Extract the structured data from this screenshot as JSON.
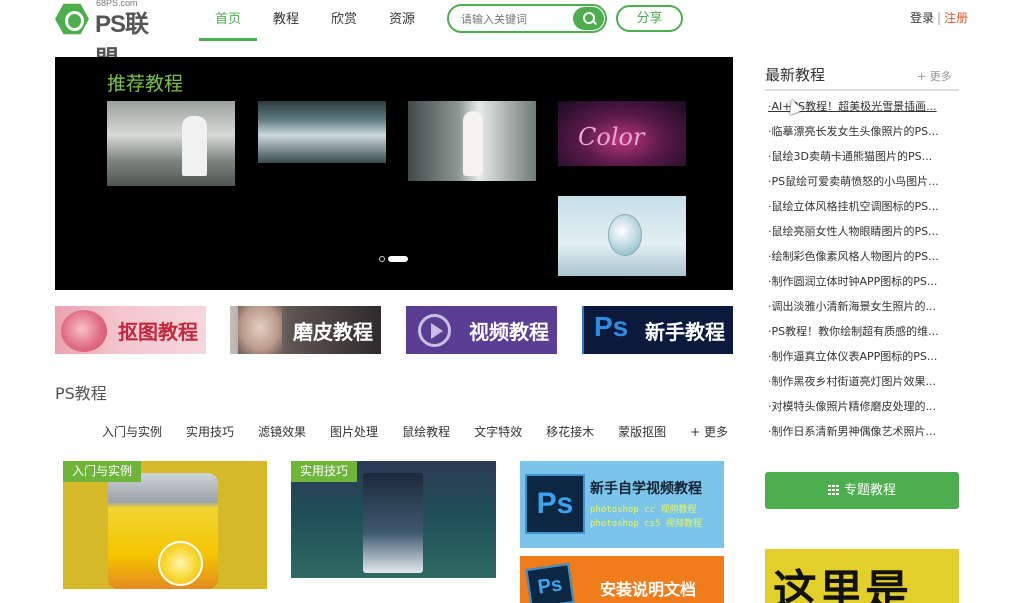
{
  "logo": {
    "sub": "68PS.com",
    "brand": "PS联盟"
  },
  "nav": {
    "items": [
      "首页",
      "教程",
      "欣赏",
      "资源"
    ]
  },
  "search": {
    "placeholder": "请输入关键词"
  },
  "share_label": "分享",
  "auth": {
    "login": "登录",
    "sep": "|",
    "register": "注册"
  },
  "banner": {
    "title": "推荐教程",
    "thumb4_text": "Color"
  },
  "categories": [
    "抠图教程",
    "磨皮教程",
    "视频教程",
    "新手教程"
  ],
  "category4_ps": "Ps",
  "section": {
    "title": "PS教程"
  },
  "subnav": [
    "入门与实例",
    "实用技巧",
    "滤镜效果",
    "图片处理",
    "鼠绘教程",
    "文字特效",
    "移花接木",
    "蒙版抠图",
    "+ 更多"
  ],
  "cards": {
    "tag1": "入门与实例",
    "tag2": "实用技巧",
    "video_title": "新手自学视频教程",
    "video_line1": "photoshop cc 视频教程",
    "video_line2": "photoshop cs5 视频教程",
    "install_title": "安装说明文档",
    "ps": "Ps"
  },
  "sidebar": {
    "title": "最新教程",
    "more": "+ 更多",
    "items": [
      "·AI+PS教程！超美极光雪景插画...",
      "·临摹漂亮长发女生头像照片的PS...",
      "·鼠绘3D卖萌卡通熊猫图片的PS...",
      "·PS鼠绘可爱卖萌愤怒的小鸟图片...",
      "·鼠绘立体风格挂机空调图标的PS...",
      "·鼠绘亮丽女性人物眼睛图片的PS...",
      "·绘制彩色像素风格人物图片的PS...",
      "·制作圆润立体时钟APP图标的PS...",
      "·调出淡雅小清新海景女生照片的...",
      "·PS教程！教你绘制超有质感的维...",
      "·制作逼真立体仪表APP图标的PS...",
      "·制作黑夜乡村街道亮灯图片效果...",
      "·对模特头像照片精修磨皮处理的...",
      "·制作日系清新男神偶像艺术照片..."
    ],
    "topic_button": "专题教程",
    "ad_text": "这里是"
  }
}
